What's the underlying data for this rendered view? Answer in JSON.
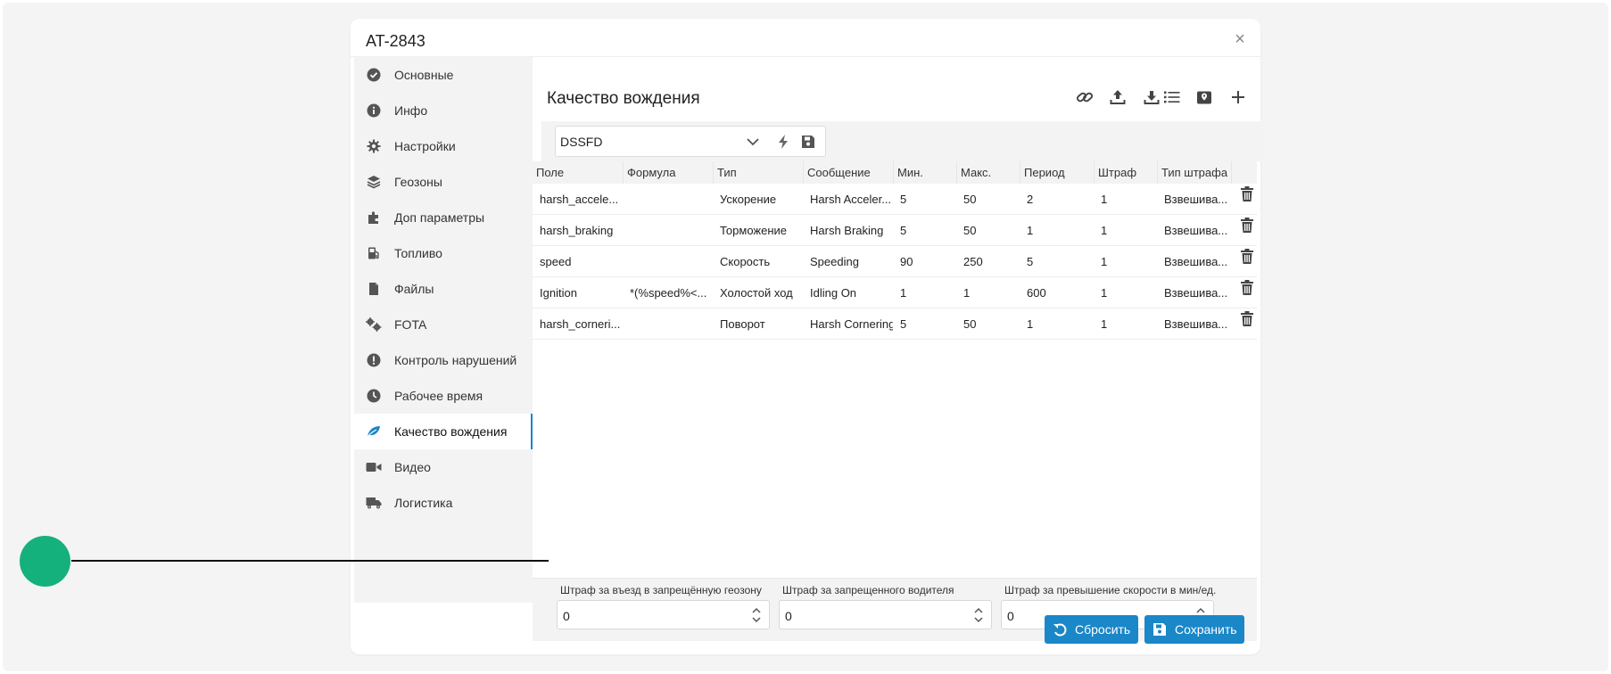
{
  "window": {
    "title": "AT-2843"
  },
  "sidebar": {
    "items": [
      {
        "label": "Основные",
        "icon": "check-circle-icon"
      },
      {
        "label": "Инфо",
        "icon": "info-icon"
      },
      {
        "label": "Настройки",
        "icon": "gear-icon"
      },
      {
        "label": "Геозоны",
        "icon": "layers-icon"
      },
      {
        "label": "Доп параметры",
        "icon": "puzzle-icon"
      },
      {
        "label": "Топливо",
        "icon": "fuel-pump-icon"
      },
      {
        "label": "Файлы",
        "icon": "file-icon"
      },
      {
        "label": "FOTA",
        "icon": "gears-icon"
      },
      {
        "label": "Контроль нарушений",
        "icon": "alert-circle-icon"
      },
      {
        "label": "Рабочее время",
        "icon": "clock-icon"
      },
      {
        "label": "Качество вождения",
        "icon": "leaf-icon",
        "active": true
      },
      {
        "label": "Видео",
        "icon": "video-icon"
      },
      {
        "label": "Логистика",
        "icon": "truck-icon"
      }
    ]
  },
  "main": {
    "title": "Качество вождения",
    "toolbar": [
      "link-icon",
      "upload-icon",
      "download-icon",
      "list-icon",
      "map-pin-icon",
      "plus-icon"
    ],
    "preset_select": {
      "value": "DSSFD"
    },
    "table": {
      "columns": [
        "Поле",
        "Формула",
        "Тип",
        "Сообщение",
        "Мин.",
        "Макс.",
        "Период",
        "Штраф",
        "Тип штрафа"
      ],
      "rows": [
        [
          "harsh_accele...",
          "",
          "Ускорение",
          "Harsh Acceler...",
          "5",
          "50",
          "2",
          "1",
          "Взвешива..."
        ],
        [
          "harsh_braking",
          "",
          "Торможение",
          "Harsh Braking",
          "5",
          "50",
          "1",
          "1",
          "Взвешива..."
        ],
        [
          "speed",
          "",
          "Скорость",
          "Speeding",
          "90",
          "250",
          "5",
          "1",
          "Взвешива..."
        ],
        [
          "Ignition",
          "*(%speed%<...",
          "Холостой ход",
          "Idling On",
          "1",
          "1",
          "600",
          "1",
          "Взвешива..."
        ],
        [
          "harsh_corneri...",
          "",
          "Поворот",
          "Harsh Cornering",
          "5",
          "50",
          "1",
          "1",
          "Взвешива..."
        ]
      ]
    },
    "penalties": [
      {
        "label": "Штраф за въезд в запрещённую геозону",
        "value": "0"
      },
      {
        "label": "Штраф за запрещенного водителя",
        "value": "0"
      },
      {
        "label": "Штраф за превышение скорости в мин/ед.",
        "value": "0"
      }
    ]
  },
  "footer": {
    "reset_label": "Сбросить",
    "save_label": "Сохранить"
  },
  "colors": {
    "accent": "#1a87c8",
    "marker": "#15b17c"
  }
}
